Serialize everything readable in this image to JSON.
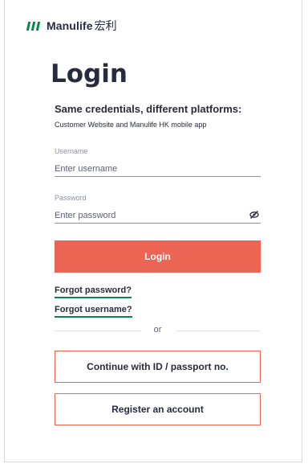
{
  "header": {
    "logo_icon": "manulife-stripes-icon",
    "brand_name": "Manulife",
    "brand_name_cn": "宏利",
    "brand_color": "#06874e"
  },
  "page_title": "Login",
  "subtitle": "Same credentials, different platforms:",
  "subtext": "Customer Website and Manulife HK mobile app",
  "username": {
    "label": "Username",
    "placeholder": "Enter username",
    "value": ""
  },
  "password": {
    "label": "Password",
    "placeholder": "Enter password",
    "value": "",
    "toggle_icon": "eye-slash-icon"
  },
  "login_button": {
    "label": "Login",
    "color": "#ec6453"
  },
  "links": {
    "forgot_password": "Forgot password?",
    "forgot_username": "Forgot username?"
  },
  "divider_text": "or",
  "id_button": {
    "label": "Continue with ID / passport no."
  },
  "register_button": {
    "label": "Register an account"
  }
}
